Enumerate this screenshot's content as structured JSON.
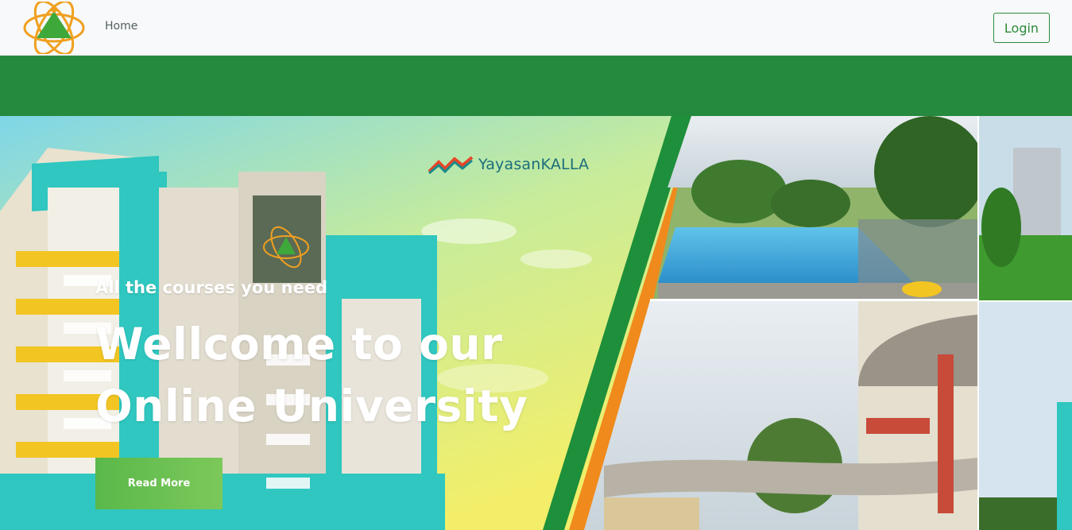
{
  "navbar": {
    "logo_icon": "atom-logo-icon",
    "home_label": "Home",
    "login_label": "Login"
  },
  "hero": {
    "brand_name_a": "Yayasan",
    "brand_name_b": "KALLA",
    "subtitle": "All the courses you need",
    "title": "Wellcome to our Online University",
    "read_more_label": "Read More"
  },
  "colors": {
    "brand_green": "#258a3d",
    "accent_orange": "#f08a1c",
    "button_green": "#5ab84a",
    "building_teal": "#2fc7c0",
    "building_yellow": "#f2c523"
  }
}
